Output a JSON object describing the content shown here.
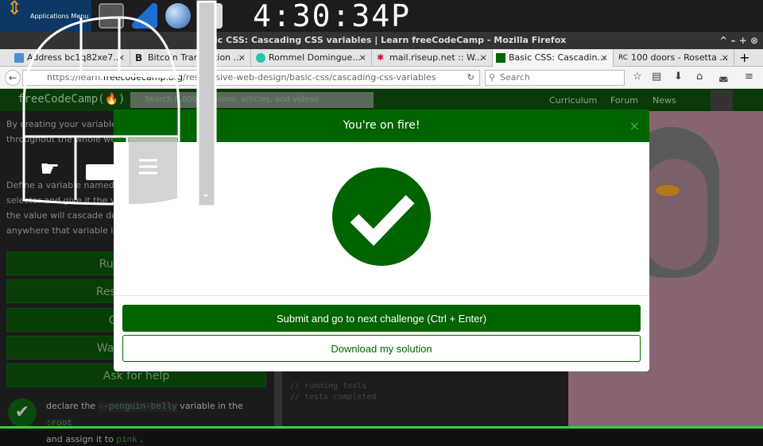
{
  "panel": {
    "app_menu": "Applications Menu",
    "clock": "4:30:34P"
  },
  "window": {
    "title": "Basic CSS: Cascading CSS variables | Learn freeCodeCamp - Mozilla Firefox",
    "controls": "^ – + ⊗"
  },
  "tabs": [
    {
      "label": "Address bc1q82xe7...",
      "color": "#4a90d9"
    },
    {
      "label": "Bitcoin Transaction ...",
      "icon": "B"
    },
    {
      "label": "Rommel Domingue...",
      "color": "#2ac3b0"
    },
    {
      "label": "mail.riseup.net :: W...",
      "color": "#d01030"
    },
    {
      "label": "Basic CSS: Cascadin...",
      "color": "#006400",
      "active": true
    },
    {
      "label": "100 doors - Rosetta ...",
      "icon": "RC"
    }
  ],
  "nav": {
    "url_prefix": "https://learn.",
    "url_domain": "freecodecamp.org",
    "url_path": "/responsive-web-design/basic-css/cascading-css-variables",
    "search_placeholder": "Search"
  },
  "fcc": {
    "logo": "freeCodeCamp(🔥)",
    "search_placeholder": "Search 8,000+ lessons, articles, and videos",
    "links": [
      "Curriculum",
      "Forum",
      "News"
    ]
  },
  "lesson": {
    "para1": "By creating your variables in the :root they will be available throughout the whole webpage.",
    "para2": "Define a variable named --penguin-belly in the :root selector and give it the value of pink. You can then see how the value will cascade down to change the value to pink, anywhere that variable is used.",
    "buttons": [
      "Run the Tests",
      "Reset All Code",
      "Get a hint",
      "Watch a video",
      "Ask for help"
    ],
    "test": {
      "t1": "declare the",
      "code1": "--penguin-belly",
      "t2": "variable in the",
      "code2": ":root",
      "t3": "and assign it to",
      "code3": "pink",
      "t4": "."
    }
  },
  "console": [
    "// running tests",
    "// tests completed"
  ],
  "modal": {
    "title": "You're on fire!",
    "close": "×",
    "submit": "Submit and go to next challenge (Ctrl + Enter)",
    "download": "Download my solution"
  },
  "colors": {
    "fcc_green": "#006400",
    "preview_bg": "#876570"
  }
}
